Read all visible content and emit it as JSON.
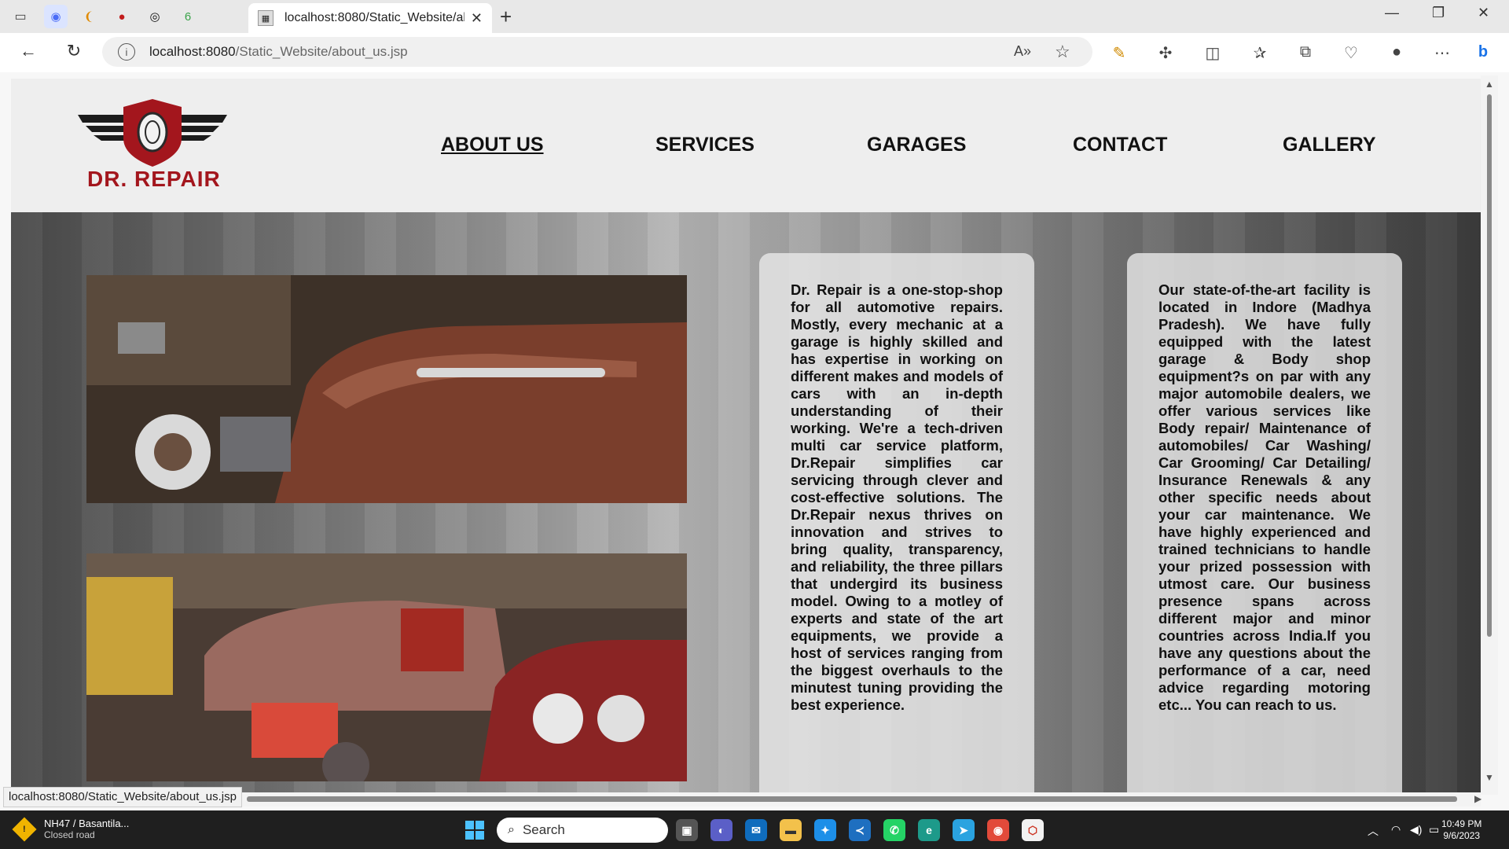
{
  "browser": {
    "tab_title": "localhost:8080/Static_Website/ab",
    "url_host": "localhost:8080",
    "url_path": "/Static_Website/about_us.jsp",
    "status_url": "localhost:8080/Static_Website/about_us.jsp"
  },
  "site": {
    "logo_text": "DR. REPAIR",
    "nav": [
      {
        "label": "ABOUT US",
        "active": true
      },
      {
        "label": "SERVICES",
        "active": false
      },
      {
        "label": "GARAGES",
        "active": false
      },
      {
        "label": "CONTACT",
        "active": false
      },
      {
        "label": "GALLERY",
        "active": false
      }
    ],
    "about_text_1": "Dr. Repair is a one-stop-shop for all automotive repairs. Mostly, every mechanic at a garage is highly skilled and has expertise in working on different makes and models of cars with an in-depth understanding of their working. We're a tech-driven multi car service platform, Dr.Repair simplifies car servicing through clever and cost-effective solutions. The Dr.Repair nexus thrives on innovation and strives to bring quality, transparency, and reliability, the three pillars that undergird its business model. Owing to a motley of experts and state of the art equipments, we provide a host of services ranging from the biggest overhauls to the minutest tuning providing the best experience.",
    "about_text_2": "Our state-of-the-art facility is located in Indore (Madhya Pradesh). We have fully equipped with the latest garage & Body shop equipment?s on par with any major automobile dealers, we offer various services like Body repair/ Maintenance of automobiles/ Car Washing/ Car Grooming/ Car Detailing/ Insurance Renewals & any other specific needs about your car maintenance. We have highly experienced and trained technicians to handle your prized possession with utmost care. Our business presence spans across different major and minor countries across India.If you have any questions about the performance of a car, need advice regarding motoring etc... You can reach to us."
  },
  "taskbar": {
    "weather_title": "NH47 / Basantila...",
    "weather_sub": "Closed road",
    "search_placeholder": "Search",
    "time": "10:49 PM",
    "date": "9/6/2023"
  },
  "colors": {
    "brand_red": "#a3161d",
    "nav_text": "#111111"
  }
}
